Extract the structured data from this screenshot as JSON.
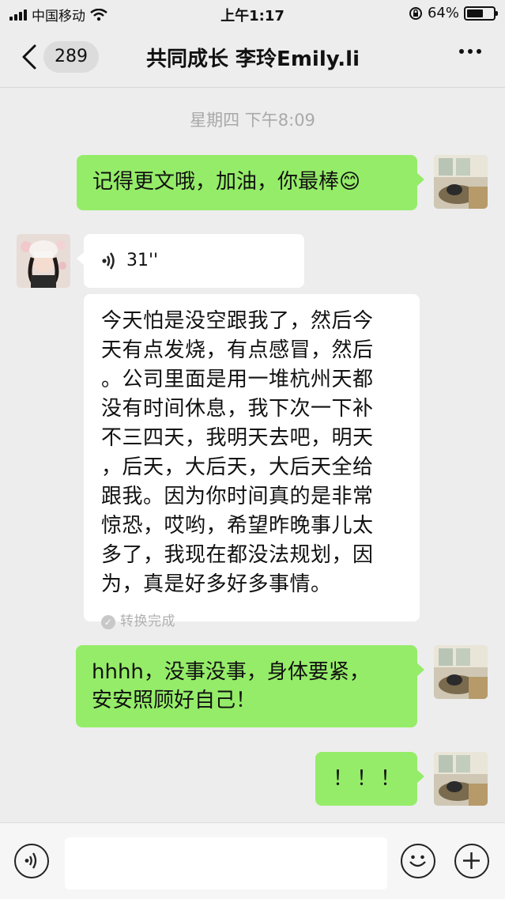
{
  "status_bar": {
    "carrier": "中国移动",
    "time": "上午1:17",
    "battery": "64%",
    "battery_level": 0.64
  },
  "header": {
    "back_label": "返回",
    "unread_count": "289",
    "title": "共同成长 李玲Emily.li"
  },
  "timestamp": "星期四 下午8:09",
  "messages": [
    {
      "side": "right",
      "type": "text",
      "text": "记得更文哦，加油，你最棒😊"
    },
    {
      "side": "left",
      "type": "voice",
      "duration": "31''"
    },
    {
      "side": "left",
      "type": "transcript",
      "lines": [
        "今天怕是没空跟我了，然后今",
        "天有点发烧，有点感冒，然后",
        "。公司里面是用一堆杭州天都",
        "没有时间休息，我下次一下补",
        "不三四天，我明天去吧，明天",
        "，后天，大后天，大后天全给",
        "跟我。因为你时间真的是非常",
        "惊恐，哎哟，希望昨晚事儿太",
        "多了，我现在都没法规划，因",
        "为，真是好多好多事情。"
      ],
      "status": "转换完成"
    },
    {
      "side": "right",
      "type": "text",
      "lines": [
        "hhhh，没事没事，身体要紧，",
        "安安照顾好自己！"
      ]
    },
    {
      "side": "right",
      "type": "text",
      "text": "！！！"
    }
  ],
  "icons": {
    "voice_input": "voice-icon",
    "emoji": "emoji-icon",
    "add": "plus-icon",
    "more": "more-icon",
    "back": "chevron-left-icon"
  },
  "colors": {
    "bubble_sent": "#95ec69",
    "bubble_received": "#ffffff",
    "background": "#ededed"
  }
}
